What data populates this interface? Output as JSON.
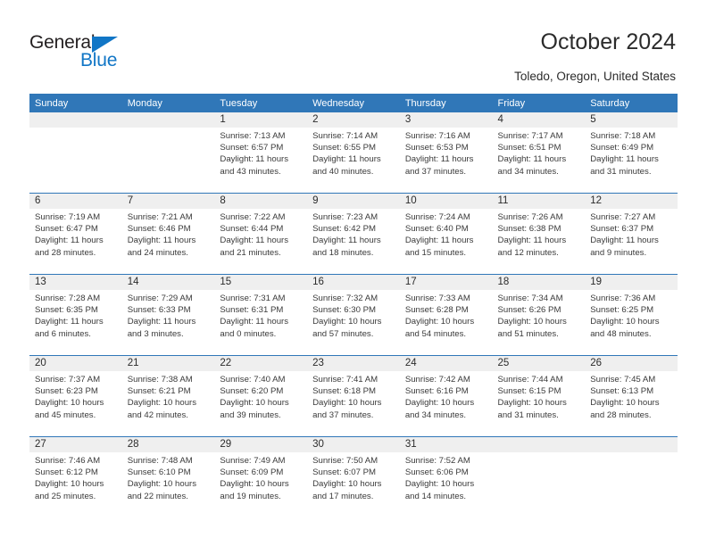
{
  "brand": {
    "name_part1": "General",
    "name_part2": "Blue",
    "accent_color": "#1176c6",
    "triangle_icon": "triangle-icon"
  },
  "header": {
    "title": "October 2024",
    "location": "Toledo, Oregon, United States"
  },
  "theme": {
    "header_blue": "#3077b8",
    "daynum_band_gray": "#efefef",
    "text_color": "#2b2b2b"
  },
  "calendar": {
    "weekday_headers": [
      "Sunday",
      "Monday",
      "Tuesday",
      "Wednesday",
      "Thursday",
      "Friday",
      "Saturday"
    ],
    "weeks": [
      [
        {
          "day": "",
          "sunrise": "",
          "sunset": "",
          "daylight": "",
          "empty": true
        },
        {
          "day": "",
          "sunrise": "",
          "sunset": "",
          "daylight": "",
          "empty": true
        },
        {
          "day": "1",
          "sunrise": "Sunrise: 7:13 AM",
          "sunset": "Sunset: 6:57 PM",
          "daylight": "Daylight: 11 hours and 43 minutes."
        },
        {
          "day": "2",
          "sunrise": "Sunrise: 7:14 AM",
          "sunset": "Sunset: 6:55 PM",
          "daylight": "Daylight: 11 hours and 40 minutes."
        },
        {
          "day": "3",
          "sunrise": "Sunrise: 7:16 AM",
          "sunset": "Sunset: 6:53 PM",
          "daylight": "Daylight: 11 hours and 37 minutes."
        },
        {
          "day": "4",
          "sunrise": "Sunrise: 7:17 AM",
          "sunset": "Sunset: 6:51 PM",
          "daylight": "Daylight: 11 hours and 34 minutes."
        },
        {
          "day": "5",
          "sunrise": "Sunrise: 7:18 AM",
          "sunset": "Sunset: 6:49 PM",
          "daylight": "Daylight: 11 hours and 31 minutes."
        }
      ],
      [
        {
          "day": "6",
          "sunrise": "Sunrise: 7:19 AM",
          "sunset": "Sunset: 6:47 PM",
          "daylight": "Daylight: 11 hours and 28 minutes."
        },
        {
          "day": "7",
          "sunrise": "Sunrise: 7:21 AM",
          "sunset": "Sunset: 6:46 PM",
          "daylight": "Daylight: 11 hours and 24 minutes."
        },
        {
          "day": "8",
          "sunrise": "Sunrise: 7:22 AM",
          "sunset": "Sunset: 6:44 PM",
          "daylight": "Daylight: 11 hours and 21 minutes."
        },
        {
          "day": "9",
          "sunrise": "Sunrise: 7:23 AM",
          "sunset": "Sunset: 6:42 PM",
          "daylight": "Daylight: 11 hours and 18 minutes."
        },
        {
          "day": "10",
          "sunrise": "Sunrise: 7:24 AM",
          "sunset": "Sunset: 6:40 PM",
          "daylight": "Daylight: 11 hours and 15 minutes."
        },
        {
          "day": "11",
          "sunrise": "Sunrise: 7:26 AM",
          "sunset": "Sunset: 6:38 PM",
          "daylight": "Daylight: 11 hours and 12 minutes."
        },
        {
          "day": "12",
          "sunrise": "Sunrise: 7:27 AM",
          "sunset": "Sunset: 6:37 PM",
          "daylight": "Daylight: 11 hours and 9 minutes."
        }
      ],
      [
        {
          "day": "13",
          "sunrise": "Sunrise: 7:28 AM",
          "sunset": "Sunset: 6:35 PM",
          "daylight": "Daylight: 11 hours and 6 minutes."
        },
        {
          "day": "14",
          "sunrise": "Sunrise: 7:29 AM",
          "sunset": "Sunset: 6:33 PM",
          "daylight": "Daylight: 11 hours and 3 minutes."
        },
        {
          "day": "15",
          "sunrise": "Sunrise: 7:31 AM",
          "sunset": "Sunset: 6:31 PM",
          "daylight": "Daylight: 11 hours and 0 minutes."
        },
        {
          "day": "16",
          "sunrise": "Sunrise: 7:32 AM",
          "sunset": "Sunset: 6:30 PM",
          "daylight": "Daylight: 10 hours and 57 minutes."
        },
        {
          "day": "17",
          "sunrise": "Sunrise: 7:33 AM",
          "sunset": "Sunset: 6:28 PM",
          "daylight": "Daylight: 10 hours and 54 minutes."
        },
        {
          "day": "18",
          "sunrise": "Sunrise: 7:34 AM",
          "sunset": "Sunset: 6:26 PM",
          "daylight": "Daylight: 10 hours and 51 minutes."
        },
        {
          "day": "19",
          "sunrise": "Sunrise: 7:36 AM",
          "sunset": "Sunset: 6:25 PM",
          "daylight": "Daylight: 10 hours and 48 minutes."
        }
      ],
      [
        {
          "day": "20",
          "sunrise": "Sunrise: 7:37 AM",
          "sunset": "Sunset: 6:23 PM",
          "daylight": "Daylight: 10 hours and 45 minutes."
        },
        {
          "day": "21",
          "sunrise": "Sunrise: 7:38 AM",
          "sunset": "Sunset: 6:21 PM",
          "daylight": "Daylight: 10 hours and 42 minutes."
        },
        {
          "day": "22",
          "sunrise": "Sunrise: 7:40 AM",
          "sunset": "Sunset: 6:20 PM",
          "daylight": "Daylight: 10 hours and 39 minutes."
        },
        {
          "day": "23",
          "sunrise": "Sunrise: 7:41 AM",
          "sunset": "Sunset: 6:18 PM",
          "daylight": "Daylight: 10 hours and 37 minutes."
        },
        {
          "day": "24",
          "sunrise": "Sunrise: 7:42 AM",
          "sunset": "Sunset: 6:16 PM",
          "daylight": "Daylight: 10 hours and 34 minutes."
        },
        {
          "day": "25",
          "sunrise": "Sunrise: 7:44 AM",
          "sunset": "Sunset: 6:15 PM",
          "daylight": "Daylight: 10 hours and 31 minutes."
        },
        {
          "day": "26",
          "sunrise": "Sunrise: 7:45 AM",
          "sunset": "Sunset: 6:13 PM",
          "daylight": "Daylight: 10 hours and 28 minutes."
        }
      ],
      [
        {
          "day": "27",
          "sunrise": "Sunrise: 7:46 AM",
          "sunset": "Sunset: 6:12 PM",
          "daylight": "Daylight: 10 hours and 25 minutes."
        },
        {
          "day": "28",
          "sunrise": "Sunrise: 7:48 AM",
          "sunset": "Sunset: 6:10 PM",
          "daylight": "Daylight: 10 hours and 22 minutes."
        },
        {
          "day": "29",
          "sunrise": "Sunrise: 7:49 AM",
          "sunset": "Sunset: 6:09 PM",
          "daylight": "Daylight: 10 hours and 19 minutes."
        },
        {
          "day": "30",
          "sunrise": "Sunrise: 7:50 AM",
          "sunset": "Sunset: 6:07 PM",
          "daylight": "Daylight: 10 hours and 17 minutes."
        },
        {
          "day": "31",
          "sunrise": "Sunrise: 7:52 AM",
          "sunset": "Sunset: 6:06 PM",
          "daylight": "Daylight: 10 hours and 14 minutes."
        },
        {
          "day": "",
          "sunrise": "",
          "sunset": "",
          "daylight": "",
          "empty": true
        },
        {
          "day": "",
          "sunrise": "",
          "sunset": "",
          "daylight": "",
          "empty": true
        }
      ]
    ]
  }
}
